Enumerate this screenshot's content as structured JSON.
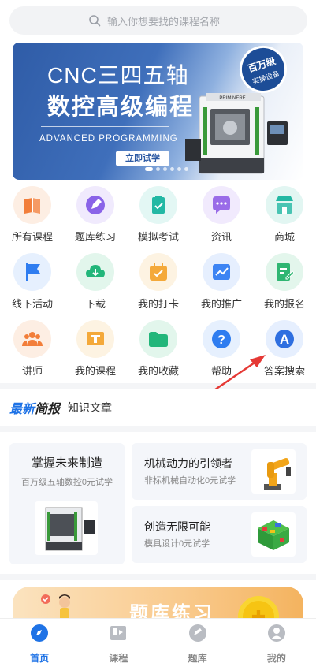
{
  "search": {
    "placeholder": "输入你想要找的课程名称"
  },
  "banner": {
    "title_line1": "CNC三四五轴",
    "title_line2": "数控高级编程",
    "subtitle": "ADVANCED PROGRAMMING",
    "cta": "立即试学",
    "badge_line1": "百万级",
    "badge_line2": "实操设备",
    "machine_brand": "PRIMINERE",
    "slide_count": 6,
    "active_slide": 1
  },
  "menu": [
    {
      "label": "所有课程",
      "icon": "book-icon",
      "color": "#f27e3a",
      "bg": "#fdeee3"
    },
    {
      "label": "题库练习",
      "icon": "pencil-icon",
      "color": "#8a63e8",
      "bg": "#f0eafd"
    },
    {
      "label": "模拟考试",
      "icon": "checklist-icon",
      "color": "#22b8a4",
      "bg": "#e3f7f4"
    },
    {
      "label": "资讯",
      "icon": "chat-bubble-icon",
      "color": "#9a6ce8",
      "bg": "#f1eafd"
    },
    {
      "label": "商城",
      "icon": "shop-icon",
      "color": "#23b8a3",
      "bg": "#e2f6f2"
    },
    {
      "label": "线下活动",
      "icon": "flag-icon",
      "color": "#2f7df0",
      "bg": "#e6f0fe"
    },
    {
      "label": "下载",
      "icon": "download-cloud-icon",
      "color": "#22b67a",
      "bg": "#e2f6ec"
    },
    {
      "label": "我的打卡",
      "icon": "calendar-check-icon",
      "color": "#f4a93a",
      "bg": "#fdf3e2"
    },
    {
      "label": "我的推广",
      "icon": "trend-chart-icon",
      "color": "#3d84f3",
      "bg": "#e6effe"
    },
    {
      "label": "我的报名",
      "icon": "edit-form-icon",
      "color": "#2fb672",
      "bg": "#e3f6ec"
    },
    {
      "label": "讲师",
      "icon": "team-icon",
      "color": "#f27e3a",
      "bg": "#fdeee3"
    },
    {
      "label": "我的课程",
      "icon": "course-board-icon",
      "color": "#f4a93a",
      "bg": "#fdf3e2"
    },
    {
      "label": "我的收藏",
      "icon": "folder-icon",
      "color": "#22b67a",
      "bg": "#e2f6ec"
    },
    {
      "label": "帮助",
      "icon": "question-icon",
      "color": "#2f7df0",
      "bg": "#e6f0fe"
    },
    {
      "label": "答案搜索",
      "icon": "letter-a-icon",
      "color": "#2f6fe0",
      "bg": "#e6effe"
    }
  ],
  "news": {
    "logo_part1": "最新",
    "logo_part2": "简报",
    "subtitle": "知识文章"
  },
  "cards": {
    "big": {
      "title": "掌握未来制造",
      "subtitle": "百万级五轴数控0元试学"
    },
    "small": [
      {
        "title": "机械动力的引领者",
        "subtitle": "非标机械自动化0元试学"
      },
      {
        "title": "创造无限可能",
        "subtitle": "模具设计0元试学"
      }
    ]
  },
  "promo": {
    "title": "题库练习"
  },
  "tabs": [
    {
      "label": "首页",
      "icon": "compass-icon",
      "active": true
    },
    {
      "label": "课程",
      "icon": "video-icon",
      "active": false
    },
    {
      "label": "题库",
      "icon": "question-bank-icon",
      "active": false
    },
    {
      "label": "我的",
      "icon": "user-icon",
      "active": false
    }
  ],
  "colors": {
    "accent": "#1f73e6",
    "banner_blue": "#2f5ca7",
    "arrow_red": "#e53935"
  }
}
